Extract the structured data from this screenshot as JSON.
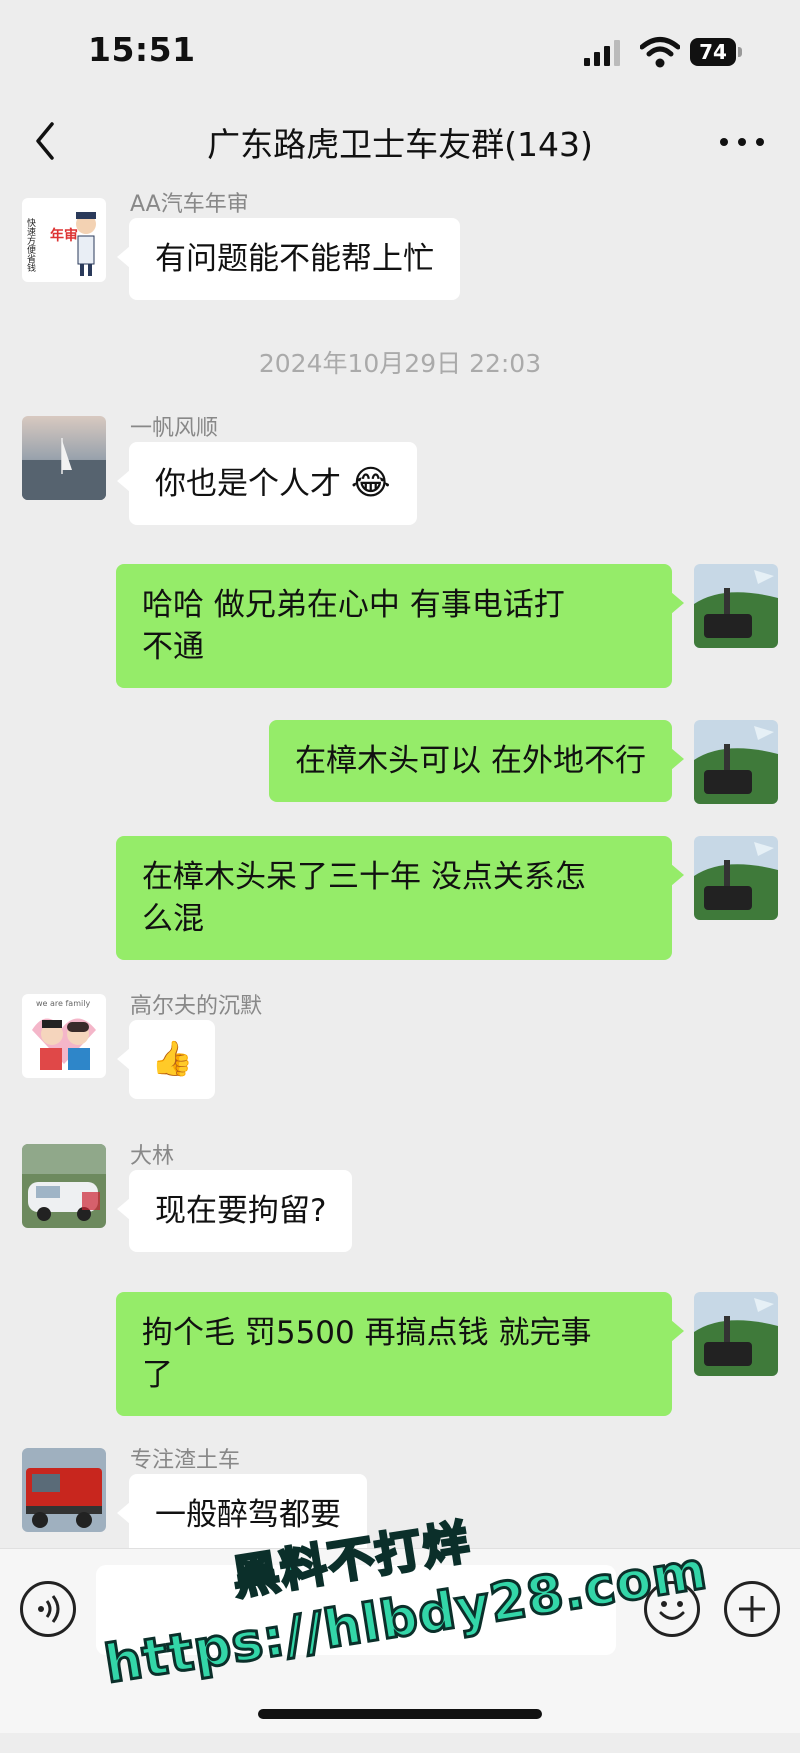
{
  "status_bar": {
    "time": "15:51",
    "battery": "74"
  },
  "nav": {
    "title": "广东路虎卫士车友群(143)"
  },
  "messages": [
    {
      "side": "left",
      "sender": "AA汽车年审",
      "text": "有问题能不能帮上忙"
    },
    {
      "timestamp": "2024年10月29日 22:03"
    },
    {
      "side": "left",
      "sender": "一帆风顺",
      "text": "你也是个人才",
      "emoji": "😂"
    },
    {
      "side": "right",
      "text_lines": [
        "哈哈 做兄弟在心中 有事电话打",
        "不通"
      ]
    },
    {
      "side": "right",
      "text": "在樟木头可以 在外地不行"
    },
    {
      "side": "right",
      "text_lines": [
        "在樟木头呆了三十年 没点关系怎",
        "么混"
      ]
    },
    {
      "side": "left",
      "sender": "高尔夫的沉默",
      "emoji": "👍"
    },
    {
      "side": "left",
      "sender": "大林",
      "text": "现在要拘留?"
    },
    {
      "side": "right",
      "text_lines": [
        "拘个毛 罚5500 再搞点钱 就完事",
        "了"
      ]
    },
    {
      "side": "left",
      "sender": "专注渣土车",
      "text": "一般醉驾都要"
    }
  ],
  "avatar_texts": {
    "aa_logo": "年审",
    "aa_side": "快速方便省钱",
    "family": "we are family"
  },
  "watermark": {
    "line1": "黑料不打烊",
    "line2": "https://hlbdy28.com"
  },
  "colors": {
    "self_bubble": "#95ec69",
    "other_bubble": "#ffffff",
    "background": "#ededed",
    "watermark": "#33d6a8"
  }
}
